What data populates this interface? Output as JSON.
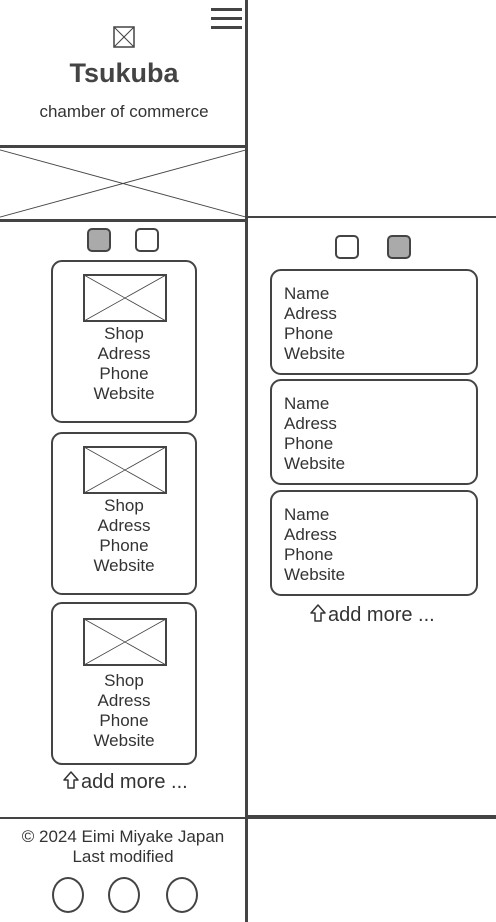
{
  "header": {
    "title": "Tsukuba",
    "subtitle": "chamber of commerce",
    "logo_icon": "image-placeholder-icon",
    "menu_icon": "hamburger-menu-icon"
  },
  "left_panel": {
    "toggles": [
      {
        "state": "active"
      },
      {
        "state": "inactive"
      }
    ],
    "shops": [
      {
        "name": "Shop",
        "address": "Adress",
        "phone": "Phone",
        "website": "Website"
      },
      {
        "name": "Shop",
        "address": "Adress",
        "phone": "Phone",
        "website": "Website"
      },
      {
        "name": "Shop",
        "address": "Adress",
        "phone": "Phone",
        "website": "Website"
      }
    ],
    "add_more": "add more ..."
  },
  "right_panel": {
    "toggles": [
      {
        "state": "inactive"
      },
      {
        "state": "active"
      }
    ],
    "contacts": [
      {
        "name": "Name",
        "address": "Adress",
        "phone": "Phone",
        "website": "Website"
      },
      {
        "name": "Name",
        "address": "Adress",
        "phone": "Phone",
        "website": "Website"
      },
      {
        "name": "Name",
        "address": "Adress",
        "phone": "Phone",
        "website": "Website"
      }
    ],
    "add_more": "add more ..."
  },
  "footer": {
    "copyright": "© 2024 Eimi Miyake Japan",
    "last_modified": "Last modified",
    "social_icons": [
      "social-icon-1",
      "social-icon-2",
      "social-icon-3"
    ]
  },
  "colors": {
    "stroke": "#444444",
    "active_toggle": "#aaaaaa",
    "background": "#ffffff"
  }
}
